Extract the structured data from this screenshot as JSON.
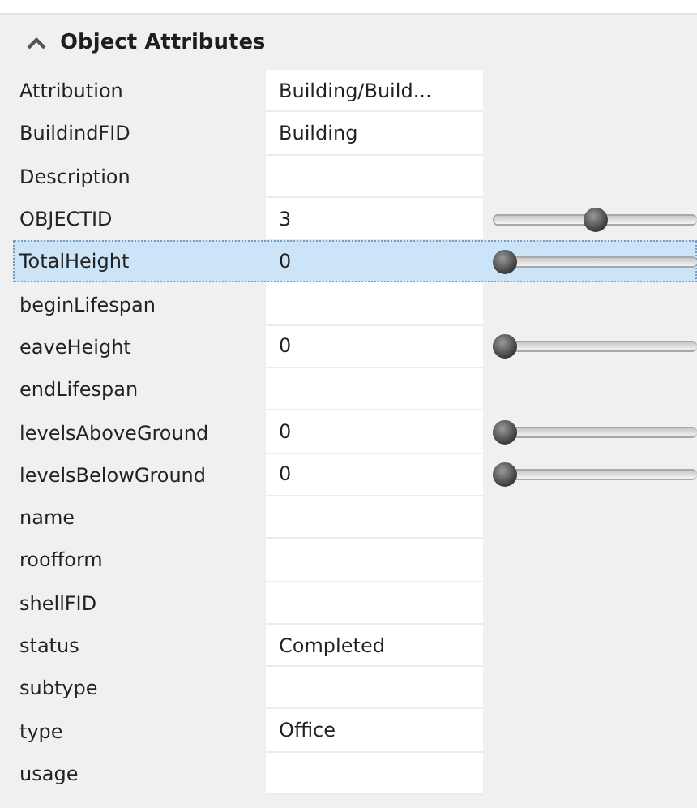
{
  "section": {
    "title": "Object Attributes",
    "expanded": true
  },
  "rows": [
    {
      "name": "Attribution",
      "value": "Building/Build...",
      "kind": "text",
      "selected": false
    },
    {
      "name": "BuildindFID",
      "value": "Building",
      "kind": "text",
      "selected": false
    },
    {
      "name": "Description",
      "kind": "text",
      "selected": false
    },
    {
      "name": "OBJECTID",
      "value": "3",
      "kind": "slider",
      "level": 0.5,
      "selected": false
    },
    {
      "name": "TotalHeight",
      "value": "0",
      "kind": "slider",
      "level": 0,
      "selected": true
    },
    {
      "name": "beginLifespan",
      "kind": "text",
      "selected": false
    },
    {
      "name": "eaveHeight",
      "value": "0",
      "kind": "slider",
      "level": 0,
      "selected": false
    },
    {
      "name": "endLifespan",
      "kind": "text",
      "selected": false
    },
    {
      "name": "levelsAboveGround",
      "value": "0",
      "kind": "slider",
      "level": 0,
      "selected": false
    },
    {
      "name": "levelsBelowGround",
      "value": "0",
      "kind": "slider",
      "level": 0,
      "selected": false
    },
    {
      "name": "name",
      "kind": "text",
      "selected": false
    },
    {
      "name": "roofform",
      "kind": "text",
      "selected": false
    },
    {
      "name": "shellFID",
      "kind": "text",
      "selected": false
    },
    {
      "name": "status",
      "value": "Completed",
      "kind": "text",
      "selected": false
    },
    {
      "name": "subtype",
      "kind": "text",
      "selected": false
    },
    {
      "name": "type",
      "value": "Office",
      "kind": "text",
      "selected": false
    },
    {
      "name": "usage",
      "kind": "text",
      "selected": false
    }
  ]
}
